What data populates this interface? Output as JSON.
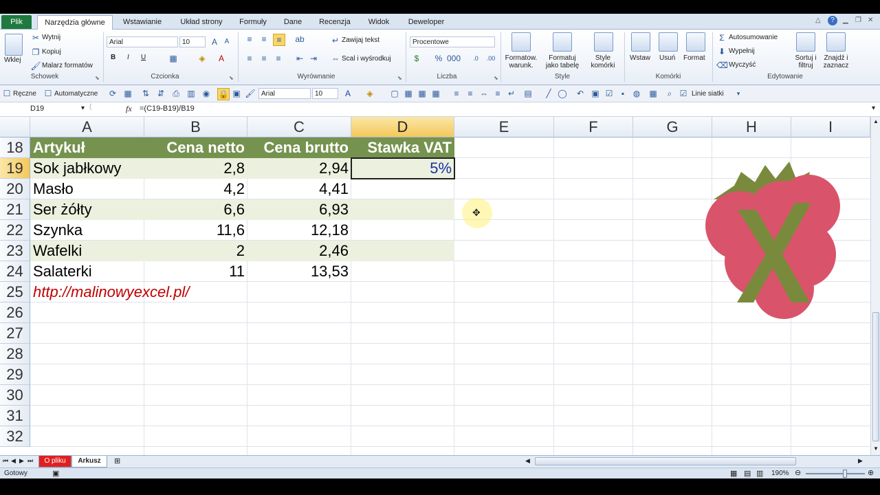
{
  "tabs": {
    "file": "Plik",
    "items": [
      "Narzędzia główne",
      "Wstawianie",
      "Układ strony",
      "Formuły",
      "Dane",
      "Recenzja",
      "Widok",
      "Deweloper"
    ]
  },
  "clipboard": {
    "paste": "Wklej",
    "cut": "Wytnij",
    "copy": "Kopiuj",
    "painter": "Malarz formatów",
    "label": "Schowek"
  },
  "font": {
    "name": "Arial",
    "size": "10",
    "label": "Czcionka",
    "bold": "B",
    "italic": "I",
    "underline": "U"
  },
  "alignment": {
    "wrap": "Zawijaj tekst",
    "merge": "Scal i wyśrodkuj",
    "label": "Wyrównanie"
  },
  "number": {
    "format": "Procentowe",
    "label": "Liczba"
  },
  "styles": {
    "conditional": [
      "Formatow.",
      "warunk."
    ],
    "as_table": [
      "Formatuj",
      "jako tabelę"
    ],
    "cell_styles": [
      "Style",
      "komórki"
    ],
    "label": "Style"
  },
  "cells": {
    "insert": "Wstaw",
    "delete": "Usuń",
    "format": "Format",
    "label": "Komórki"
  },
  "editing": {
    "autosum": "Autosumowanie",
    "fill": "Wypełnij",
    "clear": "Wyczyść",
    "sort": [
      "Sortuj i",
      "filtruj"
    ],
    "find": [
      "Znajdź i",
      "zaznacz"
    ],
    "label": "Edytowanie"
  },
  "qat": {
    "manual": "Ręczne",
    "auto": "Automatyczne",
    "font": "Arial",
    "size": "10",
    "gridlines": "Linie siatki"
  },
  "formula_bar": {
    "name_box": "D19",
    "fx": "fx",
    "formula": "=(C19-B19)/B19"
  },
  "columns": [
    "A",
    "B",
    "C",
    "D",
    "E",
    "F",
    "G",
    "H",
    "I"
  ],
  "rows": [
    "18",
    "19",
    "20",
    "21",
    "22",
    "23",
    "24",
    "25",
    "26",
    "27",
    "28",
    "29",
    "30",
    "31",
    "32"
  ],
  "table": {
    "headers": [
      "Artykuł",
      "Cena netto",
      "Cena brutto",
      "Stawka VAT"
    ],
    "data": [
      [
        "Sok jabłkowy",
        "2,8",
        "2,94",
        "5%"
      ],
      [
        "Masło",
        "4,2",
        "4,41",
        ""
      ],
      [
        "Ser żółty",
        "6,6",
        "6,93",
        ""
      ],
      [
        "Szynka",
        "11,6",
        "12,18",
        ""
      ],
      [
        "Wafelki",
        "2",
        "2,46",
        ""
      ],
      [
        "Salaterki",
        "11",
        "13,53",
        ""
      ]
    ],
    "link": "http://malinowyexcel.pl/"
  },
  "sheets": [
    "O pliku",
    "Arkusz"
  ],
  "status": {
    "ready": "Gotowy",
    "zoom": "190%"
  },
  "colors": {
    "header_fill": "#76924f",
    "band_fill": "#ebf1de",
    "link": "#c00000",
    "logo_berry": "#d9546a",
    "logo_x": "#7a8a3c"
  }
}
